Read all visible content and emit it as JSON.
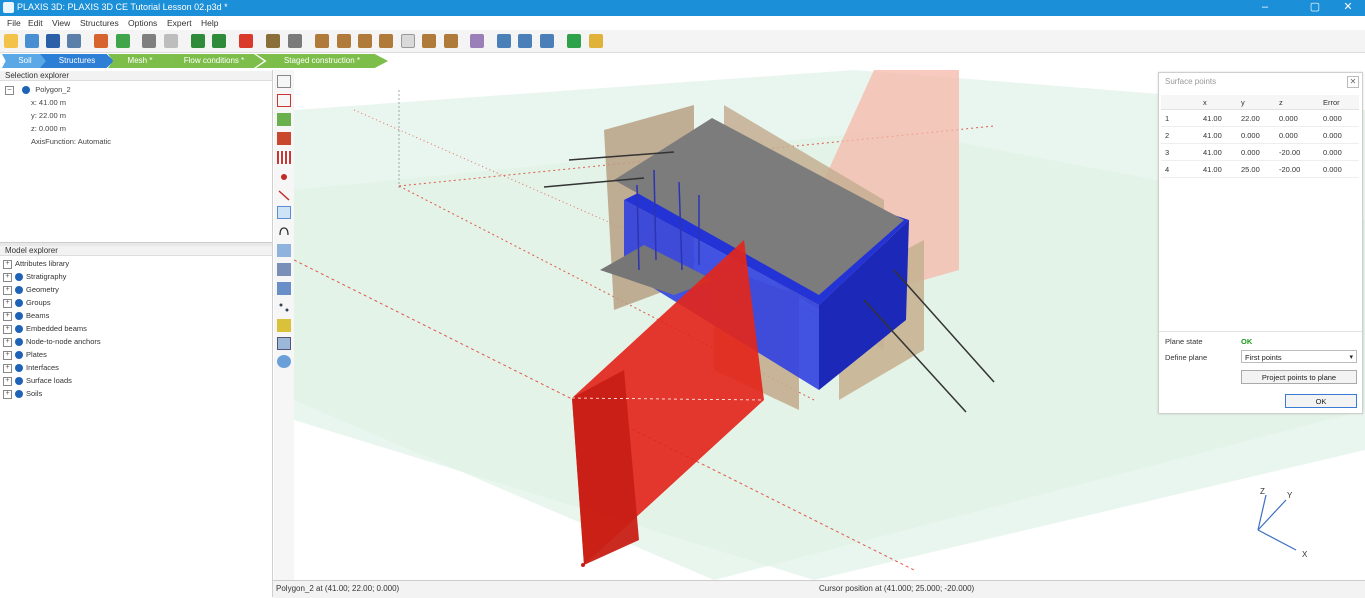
{
  "window": {
    "title": "PLAXIS 3D: PLAXIS 3D CE Tutorial Lesson 02.p3d *"
  },
  "menu": [
    "File",
    "Edit",
    "View",
    "Structures",
    "Options",
    "Expert",
    "Help"
  ],
  "tabs": [
    {
      "label": "Soil",
      "color": "#5aa8e6"
    },
    {
      "label": "Structures",
      "color": "#2d7fd6"
    },
    {
      "label": "Mesh *",
      "color": "#7dbe4a"
    },
    {
      "label": "Flow conditions *",
      "color": "#7dbe4a"
    },
    {
      "label": "Staged construction *",
      "color": "#7dbe4a"
    }
  ],
  "selection_explorer": {
    "header": "Selection explorer",
    "item": "Polygon_2",
    "x": "x: 41.00 m",
    "y": "y: 22.00 m",
    "z": "z: 0.000 m",
    "axis": "AxisFunction: Automatic"
  },
  "model_explorer": {
    "header": "Model explorer",
    "items": [
      "Attributes library",
      "Stratigraphy",
      "Geometry",
      "Groups",
      "Beams",
      "Embedded beams",
      "Node-to-node anchors",
      "Plates",
      "Interfaces",
      "Surface loads",
      "Soils"
    ]
  },
  "surface_points": {
    "title": "Surface points",
    "columns": [
      "",
      "x",
      "y",
      "z",
      "Error"
    ],
    "rows": [
      [
        "1",
        "41.00",
        "22.00",
        "0.000",
        "0.000"
      ],
      [
        "2",
        "41.00",
        "0.000",
        "0.000",
        "0.000"
      ],
      [
        "3",
        "41.00",
        "0.000",
        "-20.00",
        "0.000"
      ],
      [
        "4",
        "41.00",
        "25.00",
        "-20.00",
        "0.000"
      ]
    ],
    "plane_state_label": "Plane state",
    "plane_state_value": "OK",
    "define_plane_label": "Define plane",
    "define_plane_value": "First points",
    "project_button": "Project points to plane",
    "ok_button": "OK"
  },
  "status": {
    "left": "Polygon_2 at (41.00; 22.00; 0.000)",
    "right": "Cursor position at (41.000; 25.000; -20.000)"
  },
  "axes": {
    "x": "X",
    "y": "Y",
    "z": "Z"
  },
  "colors": {
    "accent": "#1b8fd8",
    "plane": "#e3261b",
    "structure": "#2433d6"
  }
}
